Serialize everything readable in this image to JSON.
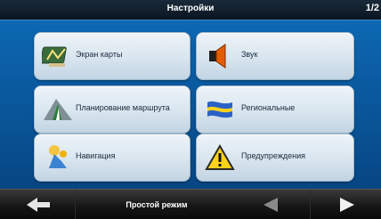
{
  "header": {
    "title": "Настройки",
    "page_indicator": "1/2"
  },
  "tiles": [
    {
      "label": "Экран карты",
      "icon": "map-screen-icon"
    },
    {
      "label": "Звук",
      "icon": "speaker-icon"
    },
    {
      "label": "Планирование маршрута",
      "icon": "route-planning-icon"
    },
    {
      "label": "Региональные",
      "icon": "flag-icon"
    },
    {
      "label": "Навигация",
      "icon": "navigation-icon"
    },
    {
      "label": "Предупреждения",
      "icon": "warning-icon"
    }
  ],
  "footer": {
    "mode_label": "Простой режим",
    "back_icon": "back-arrow-icon",
    "prev_icon": "previous-page-icon",
    "next_icon": "next-page-icon"
  },
  "colors": {
    "background": "#0a5aa0",
    "tile": "#d8e5ef",
    "bar": "#161616"
  }
}
